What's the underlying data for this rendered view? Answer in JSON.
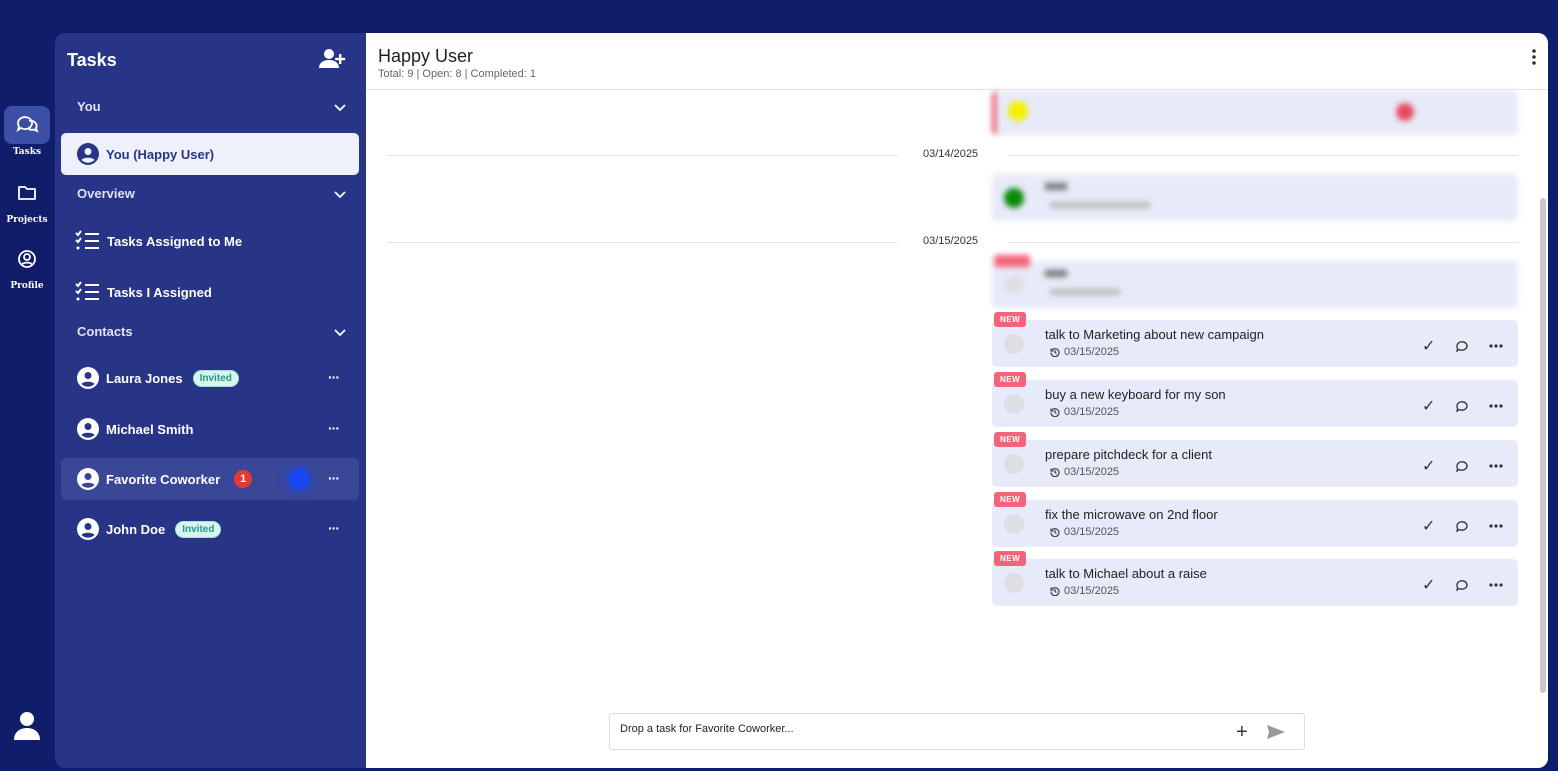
{
  "rail": {
    "items": [
      {
        "label": "Tasks",
        "icon": "chat-icon"
      },
      {
        "label": "Projects",
        "icon": "folder-icon"
      },
      {
        "label": "Profile",
        "icon": "profile-icon"
      }
    ]
  },
  "sidebar": {
    "title": "Tasks",
    "sections": {
      "you": "You",
      "overview": "Overview",
      "contacts": "Contacts"
    },
    "you_item": "You (Happy User)",
    "overview_items": [
      "Tasks Assigned to Me",
      "Tasks I Assigned"
    ],
    "contacts": [
      {
        "name": "Laura Jones",
        "badge": "Invited"
      },
      {
        "name": "Michael Smith",
        "badge": ""
      },
      {
        "name": "Favorite Coworker",
        "badge": "",
        "count": "1"
      },
      {
        "name": "John Doe",
        "badge": "Invited"
      }
    ],
    "more_label": "···"
  },
  "header": {
    "title": "Happy User",
    "stats": "Total: 9 | Open: 8 | Completed: 1"
  },
  "feed": {
    "dates": [
      "03/14/2025",
      "03/15/2025"
    ],
    "new_label": "NEW",
    "tasks": [
      {
        "title": "talk to Marketing about new campaign",
        "date": "03/15/2025"
      },
      {
        "title": "buy a new keyboard for my son",
        "date": "03/15/2025"
      },
      {
        "title": "prepare pitchdeck for a client",
        "date": "03/15/2025"
      },
      {
        "title": "fix the microwave on 2nd floor",
        "date": "03/15/2025"
      },
      {
        "title": "talk to Michael about a raise",
        "date": "03/15/2025"
      }
    ],
    "check_glyph": "✓"
  },
  "composer": {
    "placeholder": "Drop a task for Favorite Coworker...",
    "plus_glyph": "+"
  },
  "colors": {
    "rail_bg": "#0f1d6b",
    "sidebar_bg": "#283586",
    "new_badge": "#f26478",
    "task_card": "#e7eaf8",
    "invited_badge": "#d8f5ef"
  }
}
